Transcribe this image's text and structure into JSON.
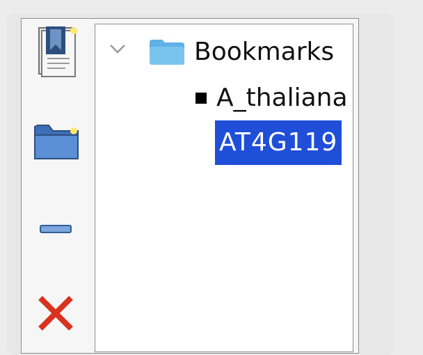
{
  "toolbar": {
    "buttons": [
      {
        "name": "add-bookmark-button",
        "icon": "bookmark-add-icon"
      },
      {
        "name": "add-folder-button",
        "icon": "folder-add-icon"
      },
      {
        "name": "add-separator-button",
        "icon": "separator-icon"
      },
      {
        "name": "delete-button",
        "icon": "delete-icon"
      }
    ]
  },
  "tree": {
    "root": {
      "label": "Bookmarks",
      "icon": "folder-icon",
      "expanded": true
    },
    "items": [
      {
        "label": "A_thaliana",
        "icon": "bullet-icon"
      },
      {
        "label": "AT4G119",
        "selected": true
      }
    ]
  },
  "colors": {
    "selection": "#1f4fd8",
    "folder": "#5fb1e6",
    "delete": "#d9321f"
  }
}
